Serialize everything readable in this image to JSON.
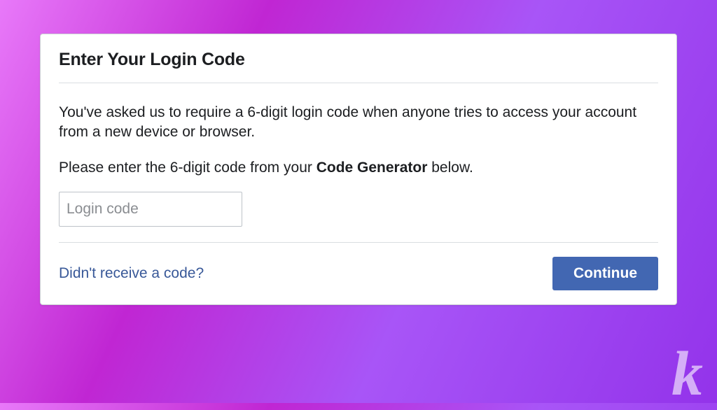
{
  "dialog": {
    "title": "Enter Your Login Code",
    "description1": "You've asked us to require a 6-digit login code when anyone tries to access your account from a new device or browser.",
    "description2_prefix": "Please enter the 6-digit code from your ",
    "description2_bold": "Code Generator",
    "description2_suffix": " below.",
    "input_placeholder": "Login code",
    "help_link": "Didn't receive a code?",
    "continue_button": "Continue"
  }
}
